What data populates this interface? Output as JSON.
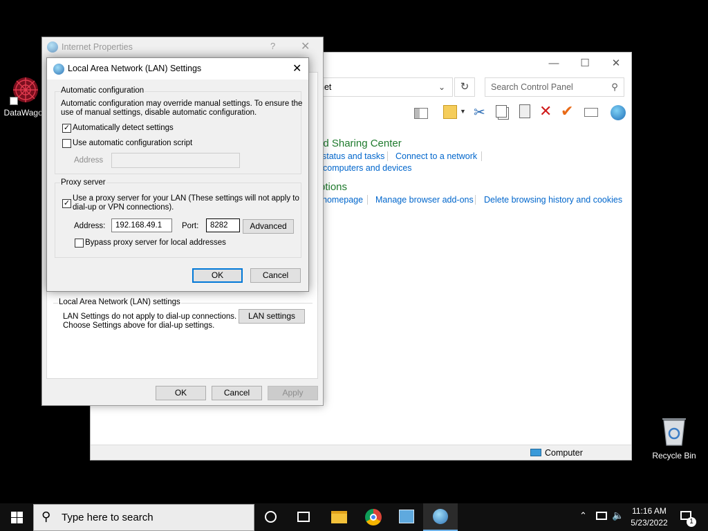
{
  "desktop": {
    "datawagon_label": "DataWagon",
    "recycle_label": "Recycle Bin"
  },
  "control_panel": {
    "address_text": "net",
    "search_placeholder": "Search Control Panel",
    "heading_network": "nd Sharing Center",
    "link_status": "status and tasks",
    "link_connect": "Connect to a network",
    "link_computers": "computers and devices",
    "heading_options": "ptions",
    "link_homepage": "homepage",
    "link_addons": "Manage browser add-ons",
    "link_history": "Delete browsing history and cookies",
    "status_computer": "Computer"
  },
  "internet_properties": {
    "title": "Internet Properties",
    "help_glyph": "?",
    "lan_group_label": "Local Area Network (LAN) settings",
    "lan_info_line1": "LAN Settings do not apply to dial-up connections.",
    "lan_info_line2": "Choose Settings above for dial-up settings.",
    "lan_settings_button": "LAN settings",
    "ok": "OK",
    "cancel": "Cancel",
    "apply": "Apply"
  },
  "lan_dialog": {
    "title": "Local Area Network (LAN) Settings",
    "auto_group_label": "Automatic configuration",
    "auto_desc_line1": "Automatic configuration may override manual settings.  To ensure the",
    "auto_desc_line2": "use of manual settings, disable automatic configuration.",
    "auto_detect_label": "Automatically detect settings",
    "auto_detect_checked": true,
    "auto_script_label": "Use automatic configuration script",
    "auto_script_checked": false,
    "script_address_label": "Address",
    "script_address_value": "",
    "proxy_group_label": "Proxy server",
    "use_proxy_line1": "Use a proxy server for your LAN (These settings will not apply to",
    "use_proxy_line2": "dial-up or VPN connections).",
    "use_proxy_checked": true,
    "proxy_address_label": "Address:",
    "proxy_address_value": "192.168.49.1",
    "port_label": "Port:",
    "port_value": "8282",
    "advanced_button": "Advanced",
    "bypass_label": "Bypass proxy server for local addresses",
    "bypass_checked": false,
    "ok": "OK",
    "cancel": "Cancel"
  },
  "taskbar": {
    "search_placeholder": "Type here to search",
    "time": "11:16 AM",
    "date": "5/23/2022",
    "notification_count": "1"
  },
  "colors": {
    "link_blue": "#0066cc",
    "heading_green": "#1e7a2c",
    "accent": "#0078d7"
  }
}
